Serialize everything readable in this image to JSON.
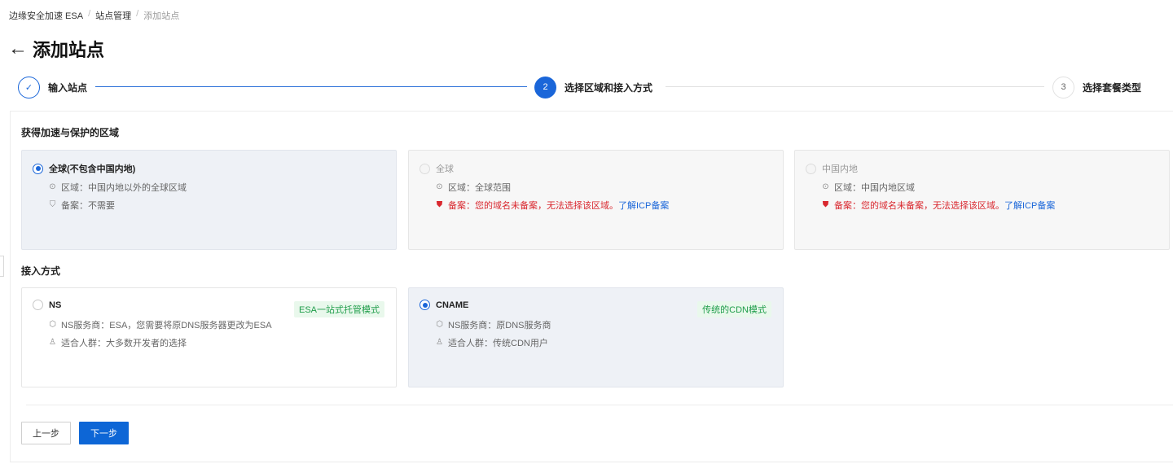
{
  "breadcrumb": {
    "items": [
      "边缘安全加速 ESA",
      "站点管理",
      "添加站点"
    ],
    "separator": "/"
  },
  "header": {
    "back_icon": "←",
    "title": "添加站点"
  },
  "steps": [
    {
      "index": "✓",
      "label": "输入站点",
      "status": "done"
    },
    {
      "index": "2",
      "label": "选择区域和接入方式",
      "status": "active"
    },
    {
      "index": "3",
      "label": "选择套餐类型",
      "status": "todo"
    }
  ],
  "region": {
    "section_title": "获得加速与保护的区域",
    "options": [
      {
        "title": "全球(不包含中国内地)",
        "area_text": "区域：中国内地以外的全球区域",
        "icp_text": "备案：不需要",
        "icp_link": "",
        "selected": true,
        "disabled": false
      },
      {
        "title": "全球",
        "area_text": "区域：全球范围",
        "icp_text": "备案：您的域名未备案，无法选择该区域。",
        "icp_link": "了解ICP备案",
        "selected": false,
        "disabled": true
      },
      {
        "title": "中国内地",
        "area_text": "区域：中国内地区域",
        "icp_text": "备案：您的域名未备案，无法选择该区域。",
        "icp_link": "了解ICP备案",
        "selected": false,
        "disabled": true
      }
    ]
  },
  "access": {
    "section_title": "接入方式",
    "options": [
      {
        "title": "NS",
        "tag": "ESA一站式托管模式",
        "provider_text": "NS服务商：ESA，您需要将原DNS服务器更改为ESA",
        "audience_text": "适合人群：大多数开发者的选择",
        "selected": false
      },
      {
        "title": "CNAME",
        "tag": "传统的CDN模式",
        "provider_text": "NS服务商：原DNS服务商",
        "audience_text": "适合人群：传统CDN用户",
        "selected": true
      }
    ]
  },
  "footer": {
    "prev_label": "上一步",
    "next_label": "下一步"
  },
  "colors": {
    "primary": "#1a66d9",
    "danger": "#d9282f",
    "success_tag_bg": "#e9f8ec",
    "success_tag_text": "#1f9d4a",
    "selected_card_bg": "#eef1f6"
  }
}
